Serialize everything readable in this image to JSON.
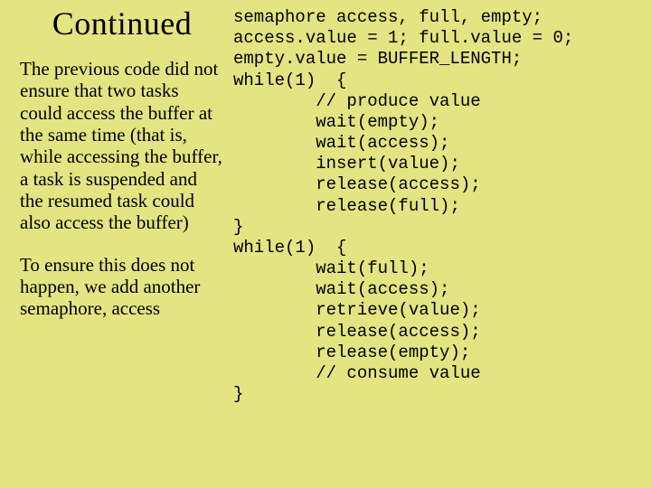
{
  "title": "Continued",
  "paragraph1": "The previous code did not ensure that two tasks could access the buffer at the same time (that is, while accessing the buffer, a task is suspended and the resumed task could also access the buffer)",
  "paragraph2": "To ensure this does not happen, we add another semaphore, access",
  "code": "semaphore access, full, empty;\naccess.value = 1; full.value = 0;\nempty.value = BUFFER_LENGTH;\nwhile(1)  {\n        // produce value\n        wait(empty);\n        wait(access);\n        insert(value);\n        release(access);\n        release(full);\n}\nwhile(1)  {\n        wait(full);\n        wait(access);\n        retrieve(value);\n        release(access);\n        release(empty);\n        // consume value\n}"
}
